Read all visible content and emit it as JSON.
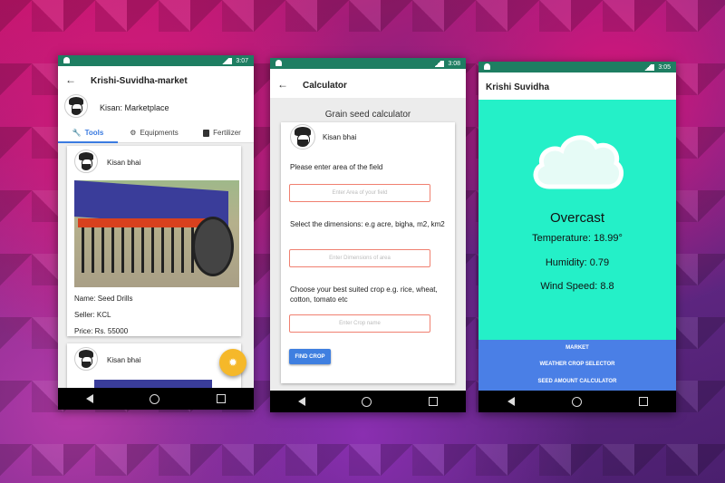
{
  "phone1": {
    "status_time": "3:07",
    "title": "Krishi-Suvidha-market",
    "header_label": "Kisan: Marketplace",
    "tabs": [
      {
        "label": "Tools",
        "icon": "wrench-icon"
      },
      {
        "label": "Equipments",
        "icon": "gear-icon"
      },
      {
        "label": "Fertilizer",
        "icon": "fertilizer-icon"
      }
    ],
    "card1": {
      "user": "Kisan bhai",
      "name": "Name:  Seed Drills",
      "seller": "Seller: KCL",
      "price": "Price: Rs. 55000"
    },
    "card2": {
      "user": "Kisan bhai"
    },
    "colors": {
      "statusbar": "#1e7e62",
      "tab_active": "#3b7be0",
      "fab": "#f5b82a"
    }
  },
  "phone2": {
    "status_time": "3:08",
    "title": "Calculator",
    "heading": "Grain seed calculator",
    "user": "Kisan bhai",
    "prompt_area": "Please enter area of the field",
    "area_placeholder": "Enter Area of your field",
    "prompt_dims": "Select the dimensions: e.g acre, bigha, m2, km2",
    "dims_placeholder": "Enter Dimensions of area",
    "prompt_crop": "Choose your best suited crop e.g. rice, wheat, cotton, tomato etc",
    "crop_placeholder": "Enter Crop name",
    "button": "FIND CROP"
  },
  "phone3": {
    "status_time": "3:05",
    "title": "Krishi Suvidha",
    "condition": "Overcast",
    "temperature": "Temperature: 18.99°",
    "humidity": "Humidity: 0.79",
    "wind": "Wind Speed: 8.8",
    "menu": [
      "MARKET",
      "WEATHER CROP SELECTOR",
      "SEED AMOUNT CALCULATOR"
    ],
    "colors": {
      "background": "#24f0c8",
      "menu": "#4a7fe6"
    }
  }
}
